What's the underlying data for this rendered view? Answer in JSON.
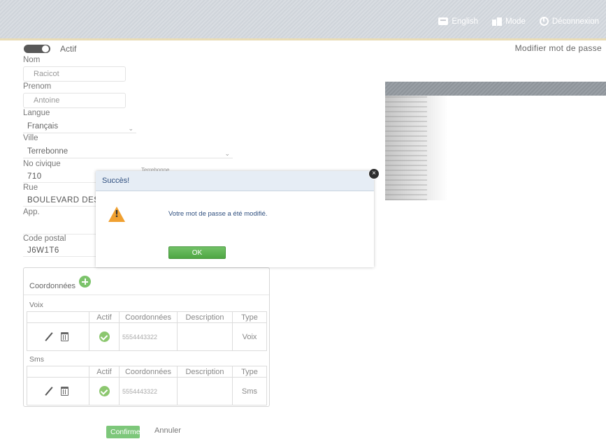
{
  "topbar": {
    "language_label": "English",
    "mode_label": "Mode",
    "logout_label": "Déconnexion"
  },
  "password_link": "Modifier mot de passe",
  "form": {
    "active_label": "Actif",
    "nom_label": "Nom",
    "nom_value": "Racicot",
    "prenom_label": "Prenom",
    "prenom_value": "Antoine",
    "langue_label": "Langue",
    "langue_value": "Français",
    "ville_label": "Ville",
    "ville_value": "Terrebonne",
    "ville_dropdown_behind": "Terrebonne",
    "no_civique_label": "No civique",
    "no_civique_value": "710",
    "rue_label": "Rue",
    "rue_value": "BOULEVARD DES",
    "app_label": "App.",
    "app_value": "",
    "code_postal_label": "Code postal",
    "code_postal_value": "J6W1T6"
  },
  "coordonnees": {
    "title": "Coordonnées",
    "voix_label": "Voix",
    "sms_label": "Sms",
    "headers": [
      "Actif",
      "Coordonnées",
      "Description",
      "Type"
    ],
    "voix_row": {
      "number": "5554443322",
      "description": "",
      "type": "Voix"
    },
    "sms_row": {
      "number": "5554443322",
      "description": "",
      "type": "Sms"
    }
  },
  "actions": {
    "confirm_label": "Confirmer",
    "cancel_label": "Annuler"
  },
  "modal": {
    "title": "Succès!",
    "message": "Votre mot de passe a été modifié.",
    "ok_label": "OK",
    "close_glyph": "×"
  },
  "icons": [
    "language-icon",
    "mode-icon",
    "power-icon",
    "add-icon",
    "edit-icon",
    "trash-icon",
    "check-icon",
    "warning-icon",
    "close-icon"
  ],
  "colors": {
    "success_green": "#7dc77a",
    "modal_title_blue": "#2f4f7f",
    "warning_orange": "#f0a030"
  }
}
